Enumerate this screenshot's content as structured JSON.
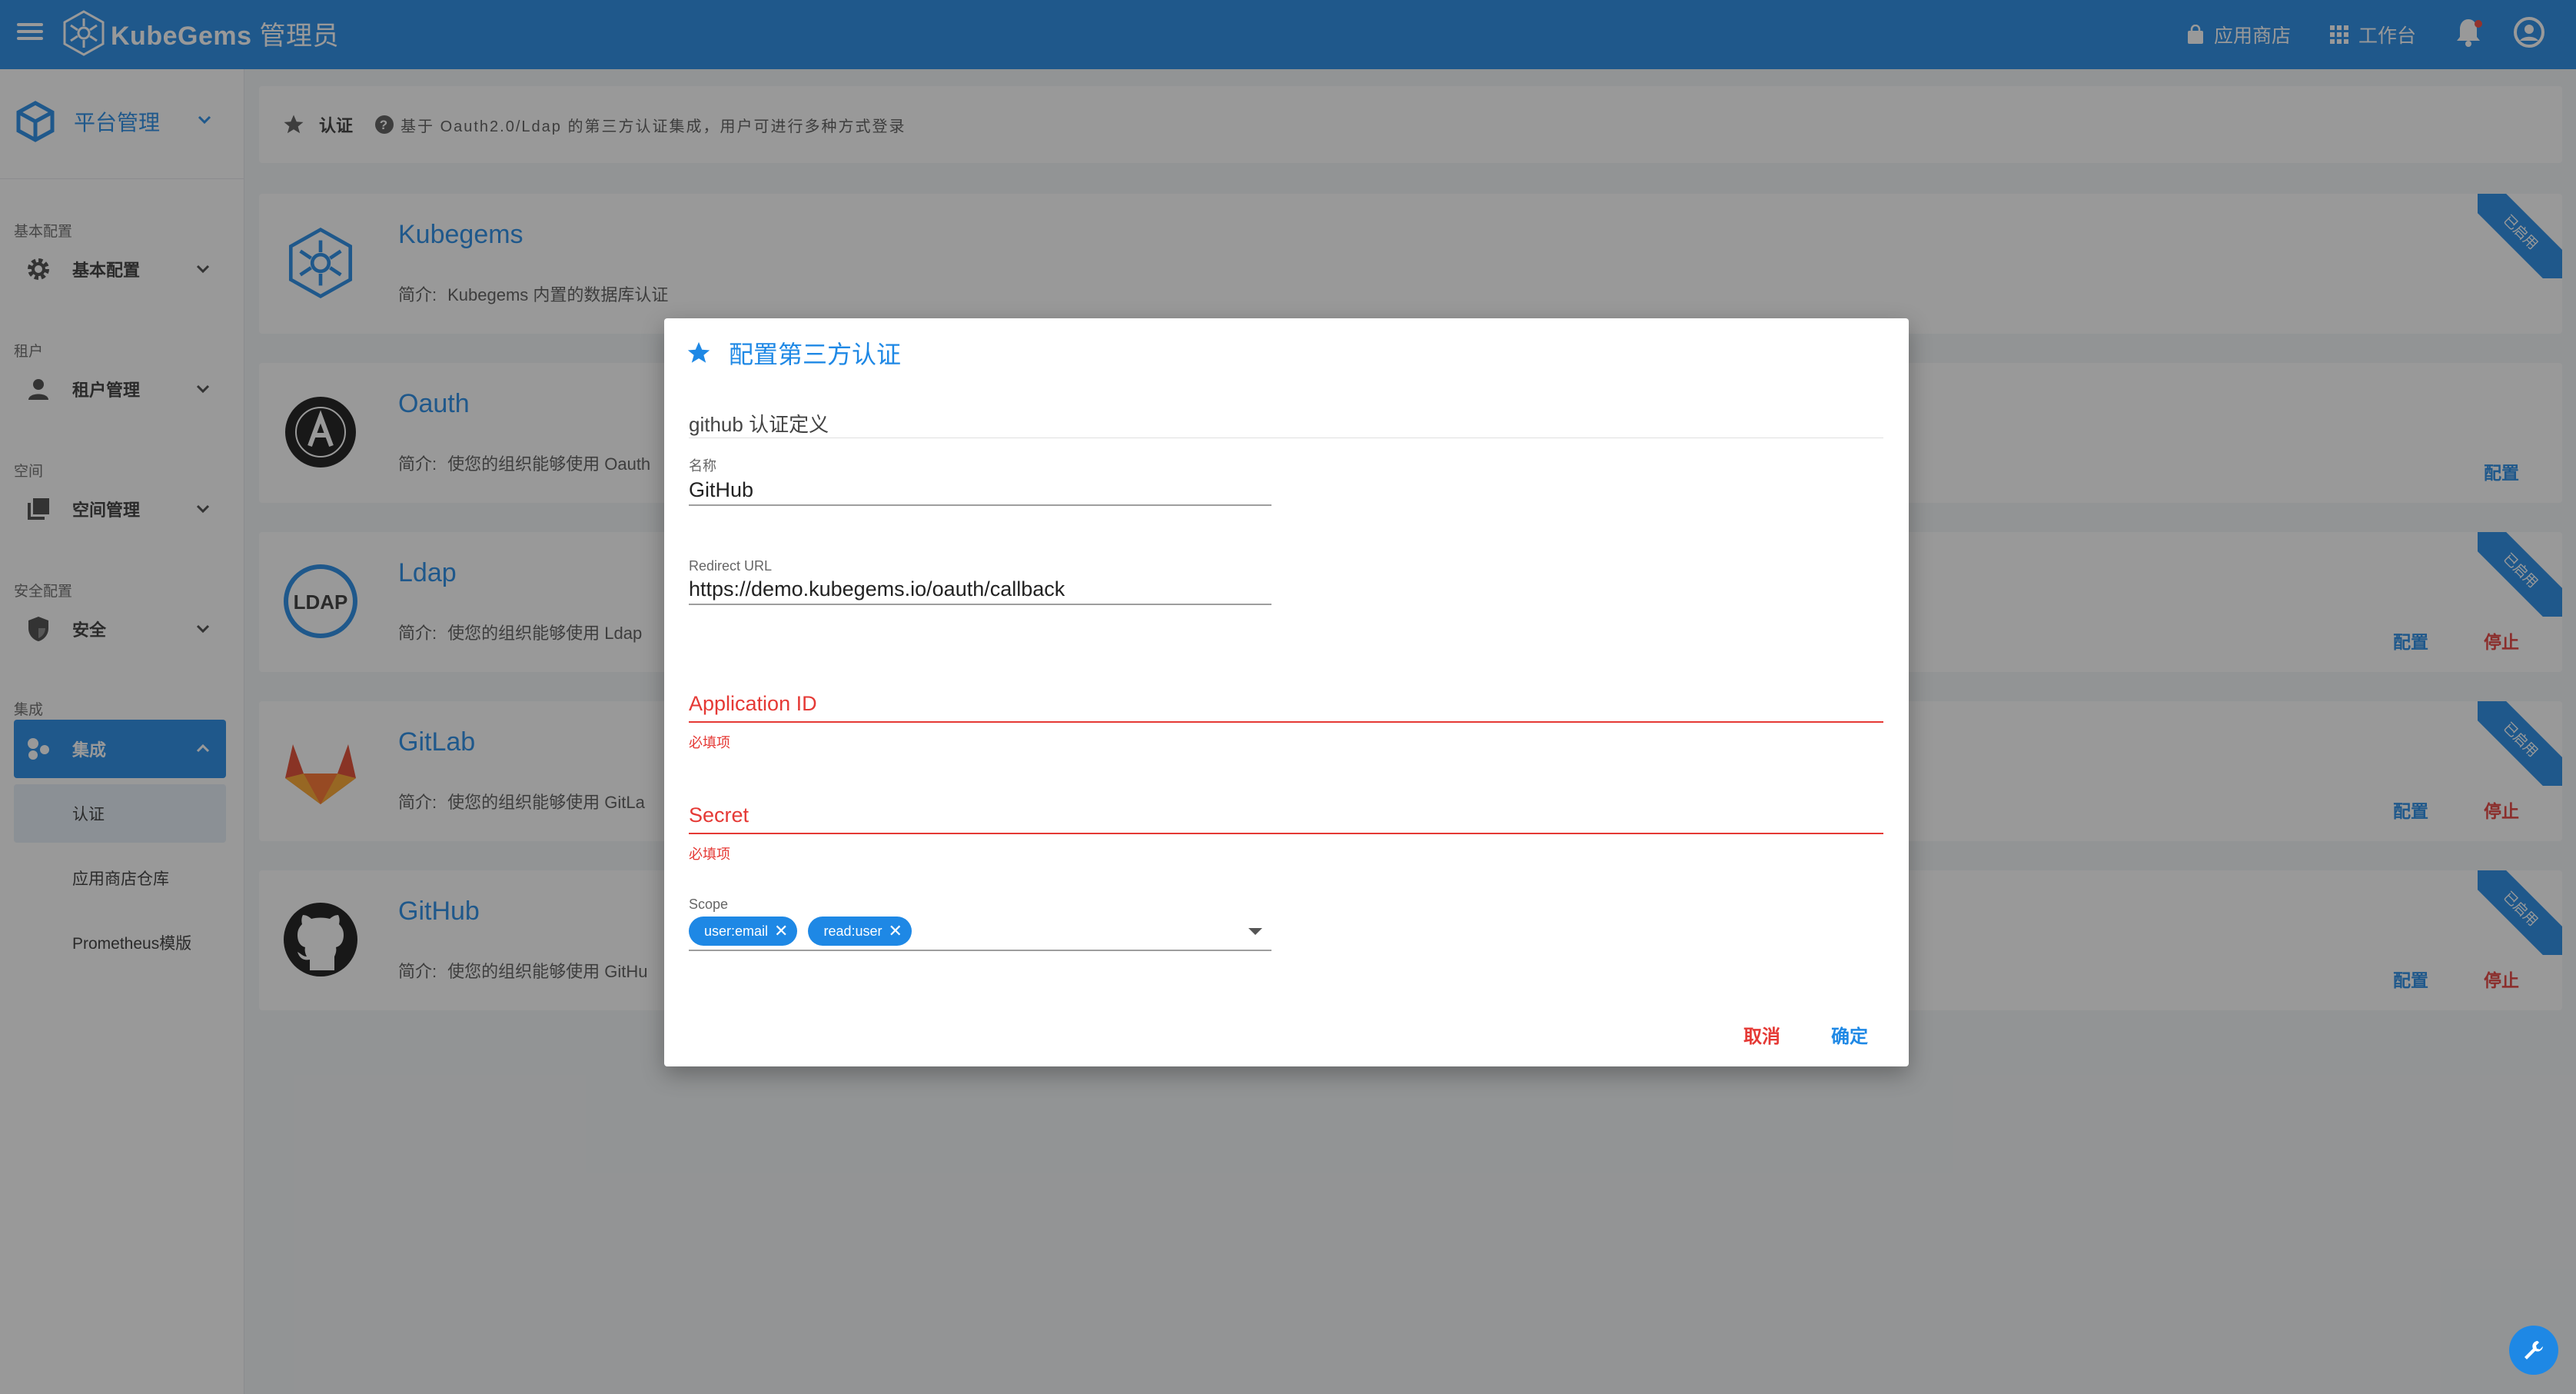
{
  "app": {
    "brand": "KubeGems",
    "role": "管理员",
    "app_store": "应用商店",
    "workbench": "工作台"
  },
  "sidebar": {
    "platform": "平台管理",
    "sections": [
      {
        "label": "基本配置",
        "item": "基本配置"
      },
      {
        "label": "租户",
        "item": "租户管理"
      },
      {
        "label": "空间",
        "item": "空间管理"
      },
      {
        "label": "安全配置",
        "item": "安全"
      },
      {
        "label": "集成",
        "item": "集成"
      }
    ],
    "sub_items": [
      "认证",
      "应用商店仓库",
      "Prometheus模版"
    ]
  },
  "breadcrumb": {
    "title": "认证",
    "help": "基于 Oauth2.0/Ldap 的第三方认证集成，用户可进行多种方式登录"
  },
  "cards": [
    {
      "name": "Kubegems",
      "desc_key": "简介:",
      "desc": "Kubegems 内置的数据库认证",
      "ribbon": "已启用"
    },
    {
      "name": "Oauth",
      "desc_key": "简介:",
      "desc": "使您的组织能够使用 Oauth",
      "config": "配置"
    },
    {
      "name": "Ldap",
      "desc_key": "简介:",
      "desc": "使您的组织能够使用 Ldap",
      "ribbon": "已启用",
      "config": "配置",
      "stop": "停止"
    },
    {
      "name": "GitLab",
      "desc_key": "简介:",
      "desc": "使您的组织能够使用 GitLa",
      "ribbon": "已启用",
      "config": "配置",
      "stop": "停止"
    },
    {
      "name": "GitHub",
      "desc_key": "简介:",
      "desc": "使您的组织能够使用 GitHu",
      "ribbon": "已启用",
      "config": "配置",
      "stop": "停止"
    }
  ],
  "dialog": {
    "title": "配置第三方认证",
    "section": "github 认证定义",
    "name_label": "名称",
    "name_value": "GitHub",
    "redirect_label": "Redirect URL",
    "redirect_value": "https://demo.kubegems.io/oauth/callback",
    "appid_label": "Application ID",
    "appid_hint": "必填项",
    "secret_label": "Secret",
    "secret_hint": "必填项",
    "scope_label": "Scope",
    "scopes": [
      "user:email",
      "read:user"
    ],
    "cancel": "取消",
    "ok": "确定"
  },
  "colors": {
    "primary": "#1e88e5",
    "error": "#e53935"
  }
}
